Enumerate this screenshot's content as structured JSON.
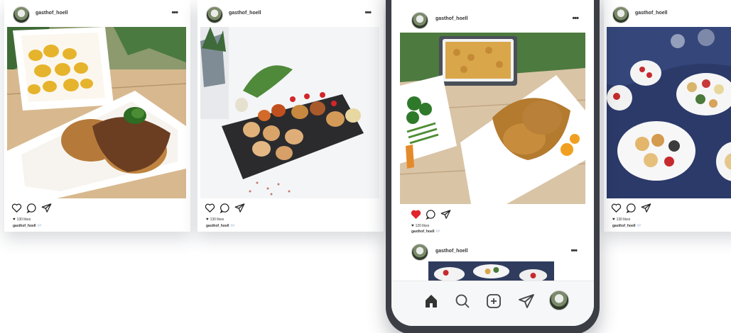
{
  "posts": [
    {
      "username": "gasthof_hoell",
      "more": "•••",
      "likes": "130 likes",
      "caption_user": "gasthof_hoell",
      "caption_tags": "##",
      "liked": false
    },
    {
      "username": "gasthof_hoell",
      "more": "•••",
      "likes": "130 likes",
      "caption_user": "gasthof_hoell",
      "caption_tags": "##",
      "liked": false
    },
    {
      "username": "gasthof_hoell",
      "more": "•••",
      "likes": "120 likes",
      "caption_user": "gasthof_hoell",
      "caption_tags": "##",
      "liked": true
    },
    {
      "username": "gasthof_hoell",
      "more": "•••",
      "likes": "130 likes",
      "caption_user": "gasthof_hoell",
      "caption_tags": "##",
      "liked": false
    },
    {
      "username": "gasthof_hoell",
      "more": "•••"
    }
  ],
  "icons": {
    "like": "heart-outline-icon",
    "liked": "heart-filled-icon",
    "comment": "speech-bubble-icon",
    "share": "paper-plane-icon",
    "home": "home-icon",
    "search": "search-icon",
    "add": "plus-square-icon",
    "send": "paper-plane-icon",
    "profile": "avatar"
  },
  "colors": {
    "like_red": "#e0262a",
    "phone_frame": "#3b3e45"
  }
}
